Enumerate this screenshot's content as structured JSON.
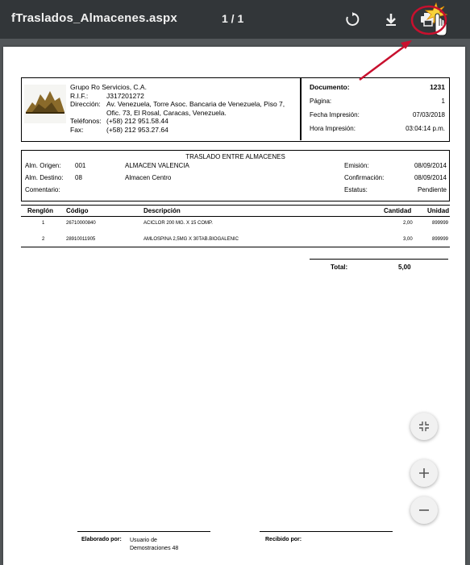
{
  "toolbar": {
    "title": "fTraslados_Almacenes.aspx",
    "page_indicator": "1 / 1",
    "icons": [
      "rotate-icon",
      "download-icon",
      "print-icon"
    ]
  },
  "company": {
    "name": "Grupo Ro Servicios, C.A.",
    "rif_label": "R.I.F.:",
    "rif": "J317201272",
    "address_label": "Dirección:",
    "address": "Av. Venezuela, Torre Asoc. Bancaria de Venezuela, Piso 7, Ofic. 73, El Rosal, Caracas, Venezuela.",
    "phone_label": "Teléfonos:",
    "phone": "(+58) 212 951.58.44",
    "fax_label": "Fax:",
    "fax": "(+58) 212 953.27.64"
  },
  "docinfo": {
    "documento_label": "Documento:",
    "documento": "1231",
    "pagina_label": "Página:",
    "pagina": "1",
    "fecha_label": "Fecha Impresión:",
    "fecha": "07/03/2018",
    "hora_label": "Hora Impresión:",
    "hora": "03:04:14 p.m."
  },
  "traslado": {
    "title": "TRASLADO ENTRE ALMACENES",
    "origen_label": "Alm. Origen:",
    "origen_code": "001",
    "origen_name": "ALMACEN VALENCIA",
    "destino_label": "Alm. Destino:",
    "destino_code": "08",
    "destino_name": "Almacen Centro",
    "comentario_label": "Comentario:",
    "emision_label": "Emisión:",
    "emision": "08/09/2014",
    "confirmacion_label": "Confirmación:",
    "confirmacion": "08/09/2014",
    "estatus_label": "Estatus:",
    "estatus": "Pendiente"
  },
  "table": {
    "headers": [
      "Renglón",
      "Código",
      "Descripción",
      "Cantidad",
      "Unidad"
    ],
    "rows": [
      {
        "renglon": "1",
        "codigo": "26710000840",
        "descripcion": "ACICLOR 200 MG. X 15 COMP.",
        "cantidad": "2,00",
        "unidad": "899999"
      },
      {
        "renglon": "2",
        "codigo": "28910011905",
        "descripcion": "AMLOSPINA 2,5MG X 30TAB.BIOGALENIC",
        "cantidad": "3,00",
        "unidad": "899999"
      }
    ],
    "total_label": "Total:",
    "total": "5,00"
  },
  "signatures": {
    "elaborado_label": "Elaborado por:",
    "elaborado_value": "Usuario de Demostraciones 48",
    "recibido_label": "Recibido por:"
  },
  "zoom": {
    "fit_icon": "fit-page-icon",
    "zoom_in_icon": "zoom-in-icon",
    "zoom_out_icon": "zoom-out-icon"
  },
  "colors": {
    "toolbar": "#323639",
    "background": "#525659",
    "annotation": "#c8102e"
  }
}
